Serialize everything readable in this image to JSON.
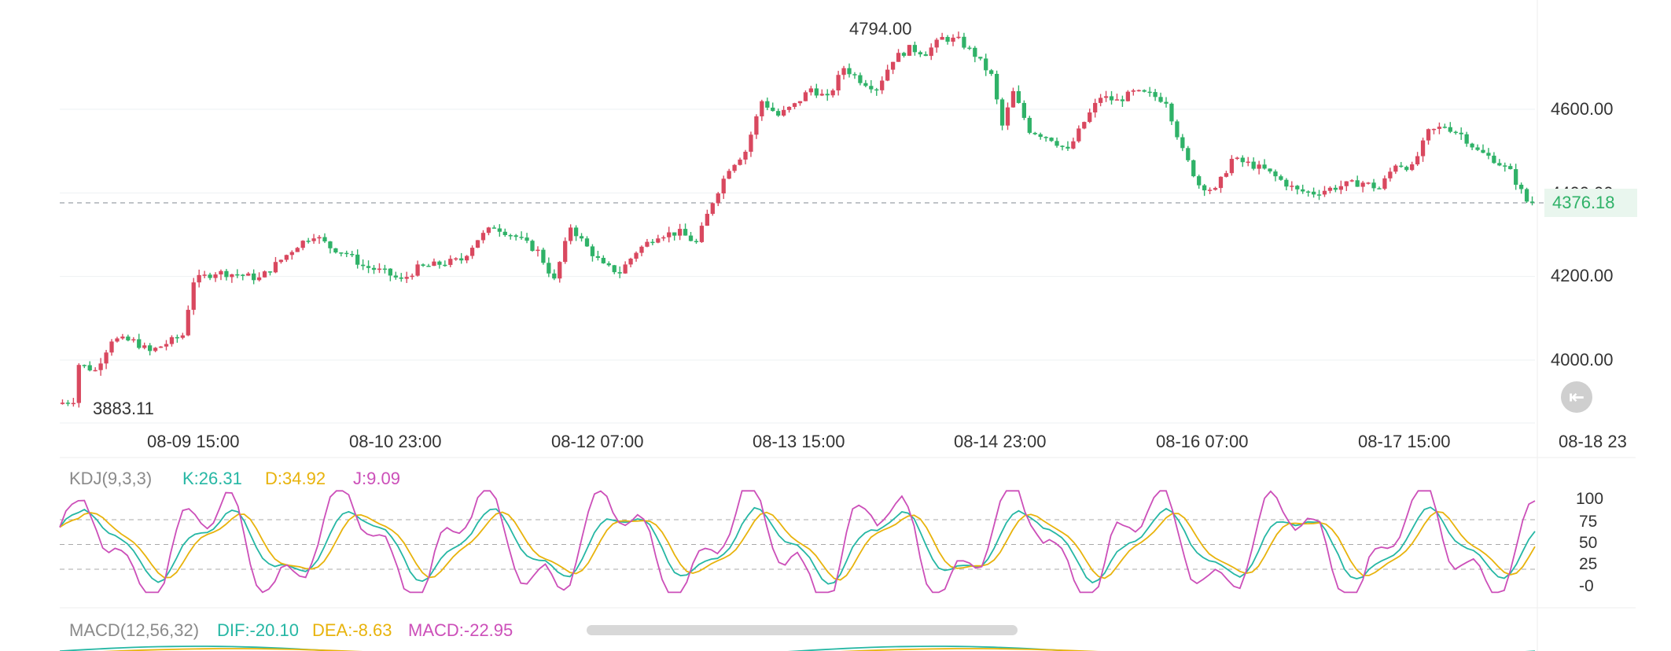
{
  "chart_data": [
    {
      "type": "candlestick",
      "title": "",
      "x_labels": [
        "08-09 15:00",
        "08-10 23:00",
        "08-12 07:00",
        "08-13 15:00",
        "08-14 23:00",
        "08-16 07:00",
        "08-17 15:00",
        "08-18 23"
      ],
      "y_ticks": [
        "4600.00",
        "4400.00",
        "4200.00",
        "4000.00"
      ],
      "ylim": [
        3850,
        4800
      ],
      "high_label": "4794.00",
      "low_label": "3883.11",
      "last_price": "4376.18",
      "up_color": "#d9485f",
      "down_color": "#2fb268",
      "price_path": [
        [
          0,
          3895
        ],
        [
          3,
          3905
        ],
        [
          4,
          3990
        ],
        [
          7,
          3975
        ],
        [
          10,
          4050
        ],
        [
          14,
          4045
        ],
        [
          17,
          4020
        ],
        [
          20,
          4040
        ],
        [
          23,
          4060
        ],
        [
          25,
          4190
        ],
        [
          29,
          4210
        ],
        [
          33,
          4205
        ],
        [
          37,
          4195
        ],
        [
          41,
          4240
        ],
        [
          44,
          4275
        ],
        [
          47,
          4300
        ],
        [
          50,
          4270
        ],
        [
          53,
          4255
        ],
        [
          56,
          4225
        ],
        [
          60,
          4210
        ],
        [
          63,
          4190
        ],
        [
          66,
          4220
        ],
        [
          70,
          4230
        ],
        [
          74,
          4240
        ],
        [
          77,
          4290
        ],
        [
          80,
          4320
        ],
        [
          84,
          4295
        ],
        [
          88,
          4260
        ],
        [
          91,
          4190
        ],
        [
          94,
          4320
        ],
        [
          97,
          4270
        ],
        [
          100,
          4225
        ],
        [
          103,
          4210
        ],
        [
          106,
          4260
        ],
        [
          110,
          4300
        ],
        [
          114,
          4305
        ],
        [
          117,
          4280
        ],
        [
          120,
          4380
        ],
        [
          123,
          4460
        ],
        [
          126,
          4500
        ],
        [
          129,
          4620
        ],
        [
          132,
          4585
        ],
        [
          135,
          4610
        ],
        [
          138,
          4650
        ],
        [
          141,
          4625
        ],
        [
          144,
          4700
        ],
        [
          147,
          4670
        ],
        [
          150,
          4650
        ],
        [
          153,
          4720
        ],
        [
          156,
          4745
        ],
        [
          159,
          4735
        ],
        [
          162,
          4770
        ],
        [
          165,
          4765
        ],
        [
          168,
          4730
        ],
        [
          171,
          4680
        ],
        [
          173,
          4560
        ],
        [
          175,
          4640
        ],
        [
          178,
          4550
        ],
        [
          182,
          4530
        ],
        [
          185,
          4500
        ],
        [
          188,
          4570
        ],
        [
          191,
          4630
        ],
        [
          194,
          4620
        ],
        [
          197,
          4640
        ],
        [
          200,
          4635
        ],
        [
          203,
          4620
        ],
        [
          206,
          4500
        ],
        [
          209,
          4420
        ],
        [
          212,
          4405
        ],
        [
          215,
          4480
        ],
        [
          218,
          4470
        ],
        [
          221,
          4455
        ],
        [
          224,
          4430
        ],
        [
          227,
          4405
        ],
        [
          230,
          4400
        ],
        [
          233,
          4410
        ],
        [
          236,
          4420
        ],
        [
          239,
          4425
        ],
        [
          242,
          4410
        ],
        [
          245,
          4470
        ],
        [
          248,
          4460
        ],
        [
          251,
          4545
        ],
        [
          254,
          4560
        ],
        [
          257,
          4540
        ],
        [
          260,
          4500
        ],
        [
          263,
          4480
        ],
        [
          266,
          4450
        ],
        [
          269,
          4380
        ]
      ],
      "series": [
        {
          "name": "4376.18",
          "role": "last"
        }
      ]
    },
    {
      "type": "line",
      "title": "KDJ(9,3,3)",
      "y_ticks": [
        "100",
        "75",
        "50",
        "25",
        "-0"
      ],
      "ylim": [
        -5,
        120
      ],
      "dashed_levels": [
        80,
        50,
        20
      ],
      "series": [
        {
          "name": "K:26.31",
          "color": "#26b7a4",
          "key": "k"
        },
        {
          "name": "D:34.92",
          "color": "#e8b30c",
          "key": "d"
        },
        {
          "name": "J:9.09",
          "color": "#cc4fb9",
          "key": "j"
        }
      ]
    },
    {
      "type": "line",
      "title": "MACD(12,56,32)",
      "series": [
        {
          "name": "DIF:-20.10",
          "color": "#26b7a4"
        },
        {
          "name": "DEA:-8.63",
          "color": "#e8b30c"
        },
        {
          "name": "MACD:-22.95",
          "color": "#cc4fb9"
        }
      ]
    }
  ],
  "controls": {
    "back_icon": "jump-to-latest-icon",
    "back_glyph": "⇤"
  }
}
